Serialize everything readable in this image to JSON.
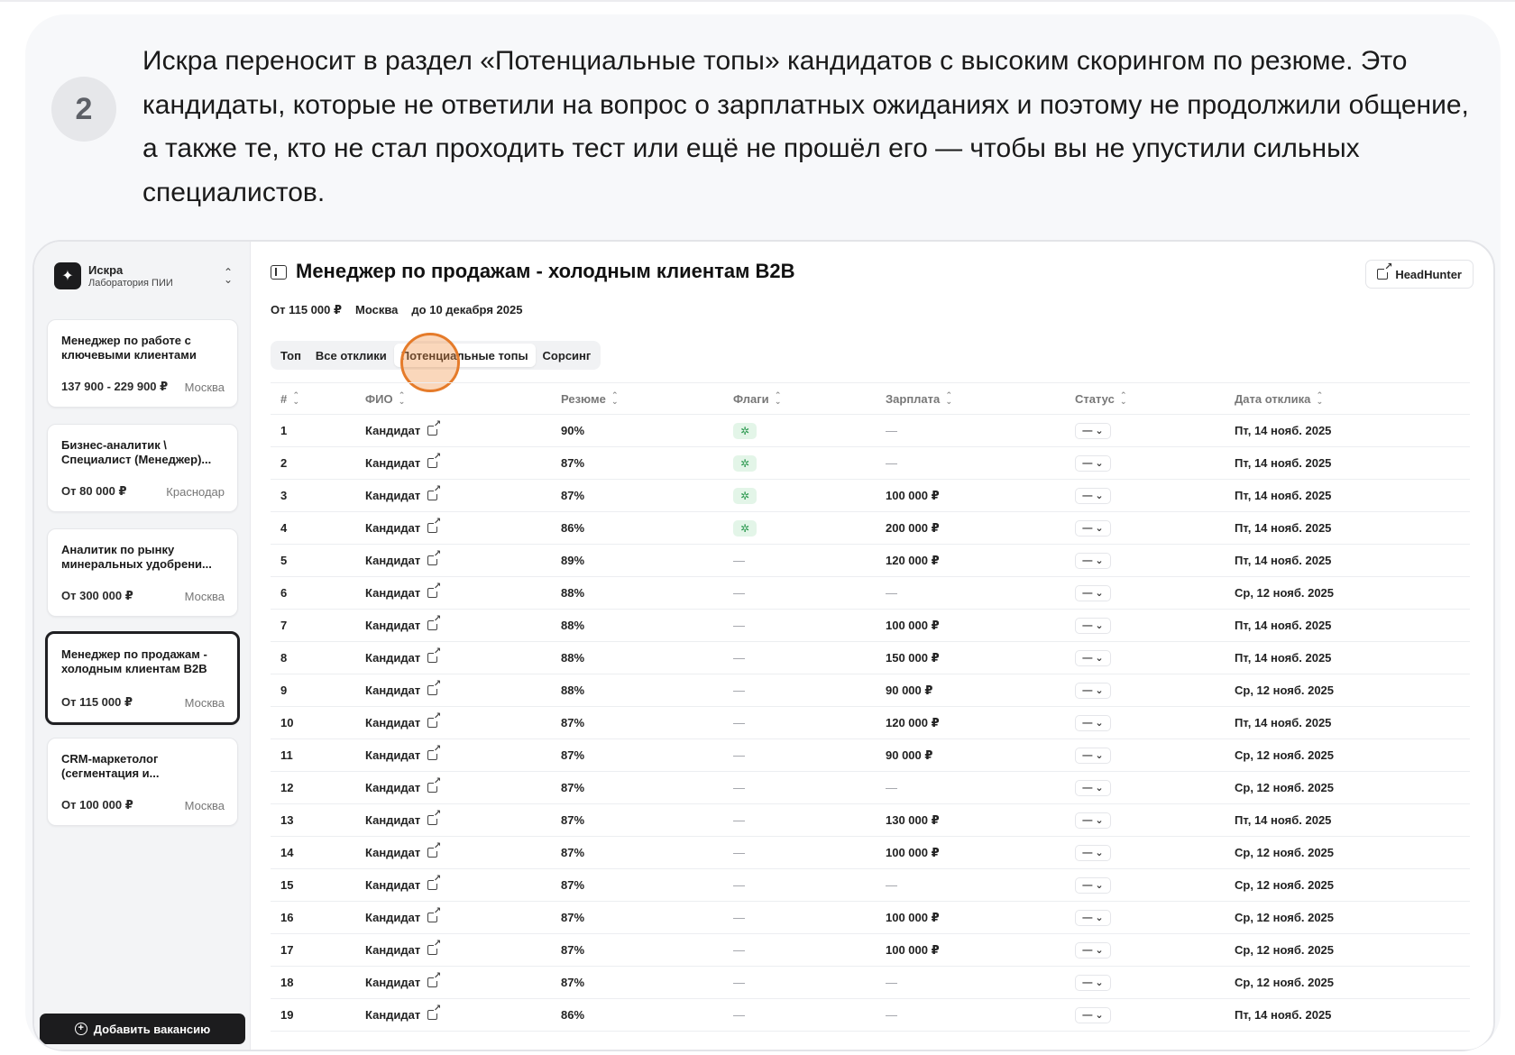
{
  "step": {
    "number": "2",
    "text": "Искра переносит в раздел «Потенциальные топы» кандидатов с высоким скорингом по резюме. Это кандидаты, которые не ответили на вопрос о зарплатных ожиданиях и поэтому не продолжили общение, а также те, кто не стал проходить тест или ещё не прошёл его — чтобы вы не упустили сильных специалистов."
  },
  "app": {
    "org_name": "Искра",
    "org_sub": "Лаборатория ПИИ",
    "add_vacancy": "Добавить вакансию"
  },
  "vacancies": [
    {
      "title": "Менеджер по работе с ключевыми клиентами",
      "salary": "137 900 - 229 900 ₽",
      "city": "Москва"
    },
    {
      "title": "Бизнес-аналитик \\ Специалист (Менеджер)...",
      "salary": "От 80 000 ₽",
      "city": "Краснодар"
    },
    {
      "title": "Аналитик по рынку минеральных удобрени...",
      "salary": "От 300 000 ₽",
      "city": "Москва"
    },
    {
      "title": "Менеджер по продажам - холодным клиентам B2B",
      "salary": "От 115 000 ₽",
      "city": "Москва"
    },
    {
      "title": "CRM-маркетолог (сегментация и...",
      "salary": "От 100 000 ₽",
      "city": "Москва"
    }
  ],
  "header": {
    "title": "Менеджер по продажам - холодным клиентам B2B",
    "headhunter": "HeadHunter",
    "salary": "От 115 000 ₽",
    "city": "Москва",
    "deadline": "до 10 декабря 2025"
  },
  "tabs": [
    "Топ",
    "Все отклики",
    "Потенциальные топы",
    "Сорсинг"
  ],
  "table": {
    "columns": [
      "#",
      "ФИО",
      "Резюме",
      "Флаги",
      "Зарплата",
      "Статус",
      "Дата отклика"
    ],
    "candidate_label": "Кандидат",
    "status_label": "— ⌄",
    "rows": [
      {
        "n": "1",
        "score": "90%",
        "flag": true,
        "salary": "—",
        "date": "Пт, 14 нояб. 2025"
      },
      {
        "n": "2",
        "score": "87%",
        "flag": true,
        "salary": "—",
        "date": "Пт, 14 нояб. 2025"
      },
      {
        "n": "3",
        "score": "87%",
        "flag": true,
        "salary": "100 000 ₽",
        "date": "Пт, 14 нояб. 2025"
      },
      {
        "n": "4",
        "score": "86%",
        "flag": true,
        "salary": "200 000 ₽",
        "date": "Пт, 14 нояб. 2025"
      },
      {
        "n": "5",
        "score": "89%",
        "flag": false,
        "salary": "120 000 ₽",
        "date": "Пт, 14 нояб. 2025"
      },
      {
        "n": "6",
        "score": "88%",
        "flag": false,
        "salary": "—",
        "date": "Ср, 12 нояб. 2025"
      },
      {
        "n": "7",
        "score": "88%",
        "flag": false,
        "salary": "100 000 ₽",
        "date": "Пт, 14 нояб. 2025"
      },
      {
        "n": "8",
        "score": "88%",
        "flag": false,
        "salary": "150 000 ₽",
        "date": "Пт, 14 нояб. 2025"
      },
      {
        "n": "9",
        "score": "88%",
        "flag": false,
        "salary": "90 000 ₽",
        "date": "Ср, 12 нояб. 2025"
      },
      {
        "n": "10",
        "score": "87%",
        "flag": false,
        "salary": "120 000 ₽",
        "date": "Пт, 14 нояб. 2025"
      },
      {
        "n": "11",
        "score": "87%",
        "flag": false,
        "salary": "90 000 ₽",
        "date": "Ср, 12 нояб. 2025"
      },
      {
        "n": "12",
        "score": "87%",
        "flag": false,
        "salary": "—",
        "date": "Ср, 12 нояб. 2025"
      },
      {
        "n": "13",
        "score": "87%",
        "flag": false,
        "salary": "130 000 ₽",
        "date": "Пт, 14 нояб. 2025"
      },
      {
        "n": "14",
        "score": "87%",
        "flag": false,
        "salary": "100 000 ₽",
        "date": "Ср, 12 нояб. 2025"
      },
      {
        "n": "15",
        "score": "87%",
        "flag": false,
        "salary": "—",
        "date": "Ср, 12 нояб. 2025"
      },
      {
        "n": "16",
        "score": "87%",
        "flag": false,
        "salary": "100 000 ₽",
        "date": "Ср, 12 нояб. 2025"
      },
      {
        "n": "17",
        "score": "87%",
        "flag": false,
        "salary": "100 000 ₽",
        "date": "Ср, 12 нояб. 2025"
      },
      {
        "n": "18",
        "score": "87%",
        "flag": false,
        "salary": "—",
        "date": "Ср, 12 нояб. 2025"
      },
      {
        "n": "19",
        "score": "86%",
        "flag": false,
        "salary": "—",
        "date": "Пт, 14 нояб. 2025"
      }
    ]
  }
}
